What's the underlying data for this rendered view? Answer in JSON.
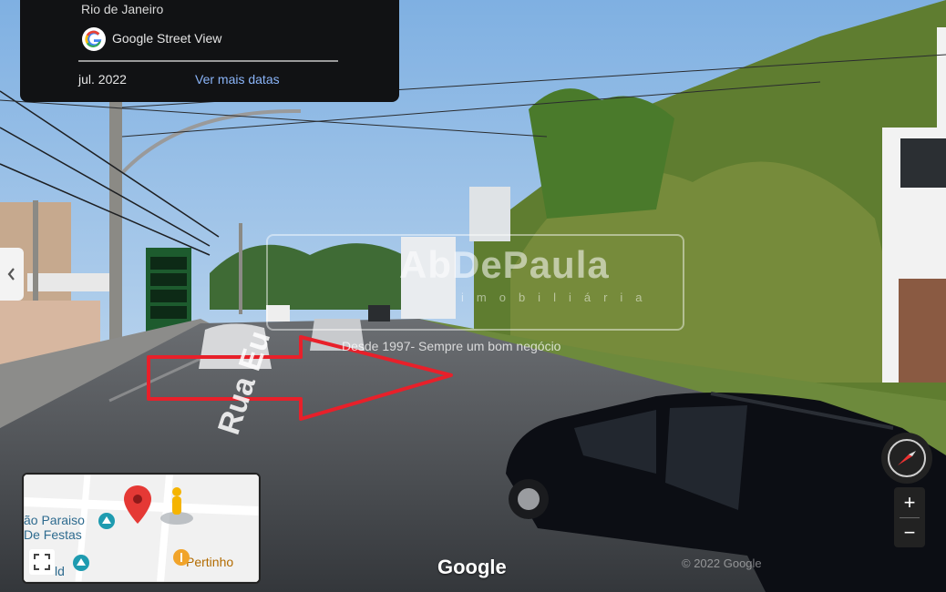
{
  "info_card": {
    "location": "Rio de Janeiro",
    "source": "Google Street View",
    "date": "jul. 2022",
    "more_dates": "Ver mais datas"
  },
  "street_name": "Rua Eu",
  "watermark": {
    "name": "AbDePaula",
    "subtitle": "imobiliária",
    "tagline": "Desde 1997- Sempre um bom negócio"
  },
  "minimap": {
    "places": [
      "ão Paraiso",
      "De Festas",
      "Pertinho",
      "ld"
    ]
  },
  "zoom": {
    "in": "+",
    "out": "−"
  },
  "footer": {
    "brand": "Google",
    "copyright": "© 2022 Google"
  },
  "colors": {
    "arrow": "#e8202a",
    "sky": "#a9c9e9",
    "hill": "#5c7a2e",
    "road": "#3b3e43",
    "car": "#0c0e14",
    "link": "#8ab4f8"
  },
  "icons": [
    "google-logo-icon",
    "chevron-left-icon",
    "compass-icon",
    "map-pin-icon",
    "pegman-icon",
    "expand-icon"
  ]
}
